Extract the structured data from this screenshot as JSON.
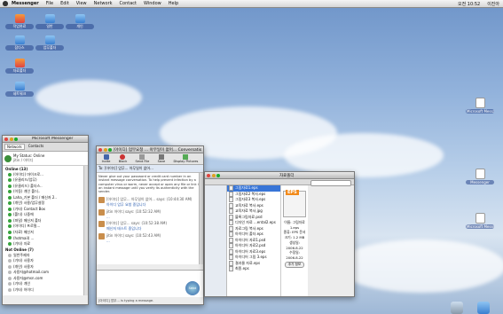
{
  "menubar": {
    "app": "Messenger",
    "items": [
      "File",
      "Edit",
      "View",
      "Network",
      "Contact",
      "Window",
      "Help"
    ],
    "clock": "오전 10:52",
    "user": "이진아"
  },
  "desktop": {
    "icons": [
      {
        "label": "작업완료"
      },
      {
        "label": "일반"
      },
      {
        "label": "개인"
      },
      {
        "label": "잡다스"
      },
      {
        "label": "업무폴더"
      },
      {
        "label": "자료폴더"
      },
      {
        "label": "네트워크"
      },
      {
        "label": "Microsoft Message"
      },
      {
        "label": "Messenger"
      },
      {
        "label": "Microsoft Messenger"
      }
    ]
  },
  "messenger": {
    "title": "Microsoft Messenger",
    "tabs": [
      "Network",
      "Contacts"
    ],
    "status": "My Status: Online",
    "name": "jitin / 아이디",
    "groups": [
      {
        "label": "Online (13)",
        "contacts": [
          "(아이디) 마이크로...",
          "(유클리드/업무)",
          "(유클리드) 폴더스..",
          "(이동) 개인 폴더..",
          "Laha_기본 폴더 / 메신저 2..",
          "(개인) 사용/업무설정",
          "(기타) Contact Box",
          "(폴더) 나중에",
          "(파일) 메신저 폴더",
          "(아이디) 프로필...",
          "(자료) 메신저",
          "(hotmail) ...",
          "(기타) 자료"
        ]
      },
      {
        "label": "Not Online (7)",
        "contacts": [
          "일반주제자",
          "(기타) 사용자",
          "(개인) 사용자",
          "사용자@hotmail.com",
          "사용자@msn.com",
          "(기타) 개인",
          "(기타) 아이디"
        ]
      }
    ]
  },
  "conversation": {
    "title": "[아이디] 업무요청 ... 아무일이 없어... Conversation",
    "toolbar": [
      "Invite",
      "Block",
      "Send File",
      "Save",
      "Display Pictures"
    ],
    "to": "To: [아이디] 업무... 아무일이 없어...",
    "warning": "Never give out your password or credit card number in an instant message conversation. To help prevent infection by a computer virus or worm, never accept or open any file or link in an instant message until you verify its authenticity with the sender.",
    "messages": [
      {
        "from": "[아이디] 업무... 아무일이 없어... says: (10:44:30 AM)",
        "text": "아이디 업무 요청 중입니다"
      },
      {
        "from": "jitin 아이디 says: (10:52:32 AM)",
        "text": "..."
      },
      {
        "from": "[아이디] 업무... says: (10:52:38 AM)",
        "text": "메신저 테스트 중입니다"
      },
      {
        "from": "jitin 아이디 says: (10:52:43 AM)",
        "text": "..."
      }
    ],
    "input": "",
    "send": "Send",
    "status": "[아이디] 업무... is typing a message."
  },
  "finder": {
    "title": "자료폴더",
    "files": [
      "그림자료1.eps",
      "그림자료2 복사.eps",
      "그림자료3 복사.eps",
      "교육자료 복사.eps",
      "교육자료 복사.jpg",
      "블록그림자료.psd",
      "디자인 자료 ...ental2.eps",
      "자료그림 복사.eps",
      "아이디어 폴더.eps",
      "아이디어 자료1.psd",
      "아이디어 자료2.psd",
      "아이디어 자료3.eps",
      "아이디어 그림 3.eps",
      "결과물 자료.eps",
      "최종.eps"
    ],
    "preview": {
      "badge": "EPS",
      "info": [
        "이름: 그림자료1.eps",
        "종류: EPS 문서",
        "크기: 1.2 MB",
        "생성일: 2006.8.22",
        "수정일: 2006.8.22"
      ],
      "button": "추가 정보"
    }
  },
  "dock": {
    "items": [
      "휴지통",
      "문서"
    ]
  }
}
